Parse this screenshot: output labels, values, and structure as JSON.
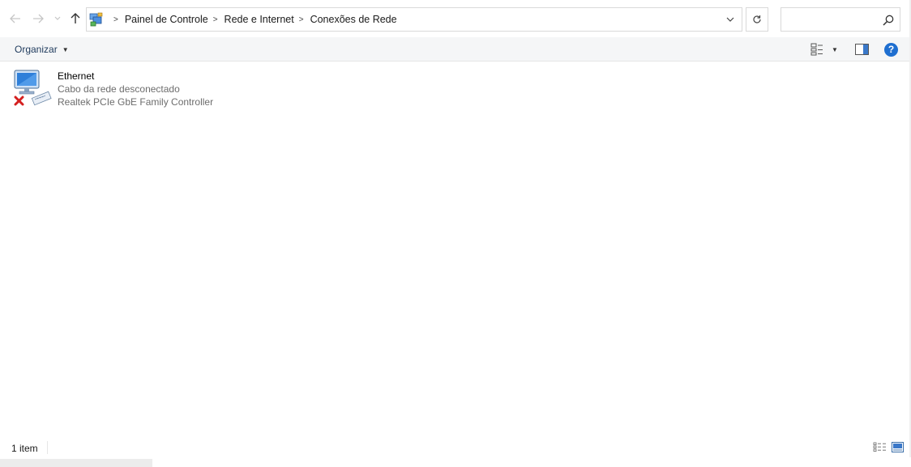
{
  "window": {
    "title": "Conexões de Rede"
  },
  "nav": {
    "back_icon": "arrow-left-icon",
    "forward_icon": "arrow-right-icon",
    "recent_icon": "chevron-down-icon",
    "up_icon": "arrow-up-icon"
  },
  "address": {
    "icon": "control-panel-network-icon",
    "breadcrumbs": [
      {
        "label": "Painel de Controle"
      },
      {
        "label": "Rede e Internet"
      },
      {
        "label": "Conexões de Rede"
      }
    ],
    "separator": ">",
    "dropdown_icon": "chevron-down-icon"
  },
  "refresh": {
    "icon": "refresh-icon"
  },
  "search": {
    "value": "",
    "placeholder": "",
    "icon": "search-icon"
  },
  "toolbar": {
    "organize_label": "Organizar",
    "view_icon": "change-view-icon",
    "preview_icon": "preview-pane-icon",
    "help_icon": "help-icon",
    "help_glyph": "?"
  },
  "items": [
    {
      "name": "Ethernet",
      "status": "Cabo da rede desconectado",
      "device": "Realtek PCIe GbE Family Controller",
      "icon": "network-adapter-disconnected-icon"
    }
  ],
  "statusbar": {
    "count": "1 item",
    "details_icon": "details-view-icon",
    "tiles_icon": "large-icons-view-icon"
  },
  "colors": {
    "accent": "#1f6fd0",
    "link_text": "#1e3a5c",
    "subtle_text": "#6d6d6d",
    "error_red": "#d42020"
  }
}
